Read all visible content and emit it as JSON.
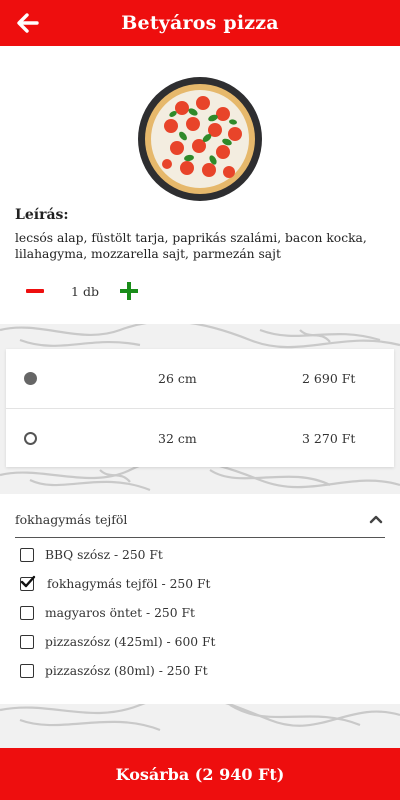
{
  "header": {
    "title": "Betyáros pizza",
    "back_icon": "arrow-left-icon"
  },
  "product": {
    "image_icon": "pizza-image",
    "description_title": "Leírás:",
    "description": "lecsós alap, füstölt tarja, paprikás szalámi, bacon kocka, lilahagyma, mozzarella sajt, parmezán sajt",
    "quantity": "1 db"
  },
  "sizes": [
    {
      "label": "26 cm",
      "price": "2 690 Ft",
      "selected": true
    },
    {
      "label": "32 cm",
      "price": "3 270 Ft",
      "selected": false
    }
  ],
  "sauce": {
    "selected_label": "fokhagymás tejföl",
    "options": [
      {
        "label": "BBQ szósz - 250 Ft",
        "checked": false
      },
      {
        "label": "fokhagymás tejföl - 250 Ft",
        "checked": true
      },
      {
        "label": "magyaros öntet - 250 Ft",
        "checked": false
      },
      {
        "label": "pizzaszósz (425ml) - 600 Ft",
        "checked": false
      },
      {
        "label": "pizzaszósz (80ml) - 250 Ft",
        "checked": false
      }
    ]
  },
  "footer": {
    "cart_label": "Kosárba (2 940 Ft)"
  },
  "colors": {
    "accent": "#ee0e0e",
    "plus": "#1a8d1a"
  }
}
